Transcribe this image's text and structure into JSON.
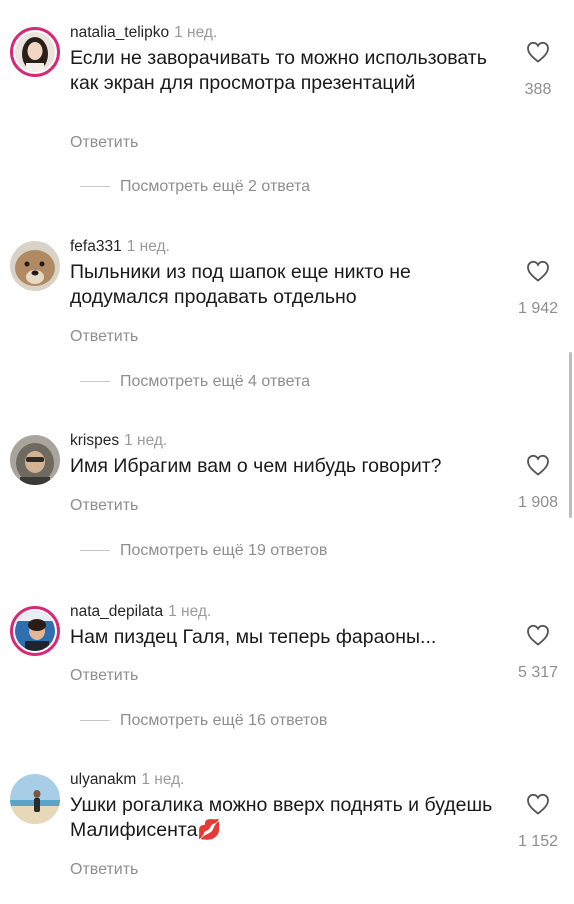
{
  "comments": [
    {
      "username": "natalia_telipko",
      "time": "1 нед.",
      "text": "Если не заворачивать то можно использовать как экран для просмотра презентаций",
      "reply_label": "Ответить",
      "likes": "388",
      "view_replies": "Посмотреть ещё 2 ответа",
      "avatar_icon": "avatar-woman-dark-hair"
    },
    {
      "username": "fefa331",
      "time": "1 нед.",
      "text": "Пыльники из под шапок еще никто не додумался продавать отдельно",
      "reply_label": "Ответить",
      "likes": "1 942",
      "view_replies": "Посмотреть ещё 4 ответа",
      "avatar_icon": "avatar-dog"
    },
    {
      "username": "krispes",
      "time": "1 нед.",
      "text": "Имя Ибрагим вам о чем нибудь говорит?",
      "reply_label": "Ответить",
      "likes": "1 908",
      "view_replies": "Посмотреть ещё 19 ответов",
      "avatar_icon": "avatar-hooded-person"
    },
    {
      "username": "nata_depilata",
      "time": "1 нед.",
      "text": "Нам пиздец Галя, мы теперь фараоны...",
      "reply_label": "Ответить",
      "likes": "5 317",
      "view_replies": "Посмотреть ещё 16 ответов",
      "avatar_icon": "avatar-woman-blue-background"
    },
    {
      "username": "ulyanakm",
      "time": "1 нед.",
      "text": "Ушки рогалика можно вверх поднять и будешь Малифисента💋",
      "reply_label": "Ответить",
      "likes": "1 152",
      "avatar_icon": "avatar-beach-photo"
    }
  ],
  "colors": {
    "story_ring": "#d62976",
    "secondary_text": "#8e8e8e",
    "primary_text": "#262626"
  }
}
